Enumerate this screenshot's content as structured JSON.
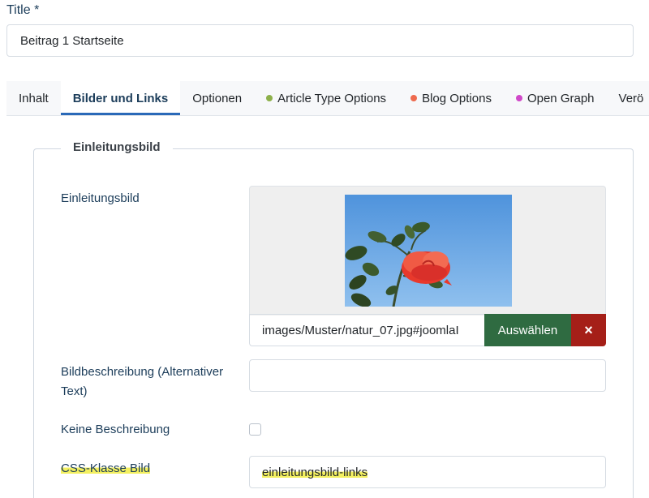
{
  "title_field": {
    "label": "Title *",
    "value": "Beitrag 1 Startseite"
  },
  "tabs": [
    {
      "label": "Inhalt",
      "active": false,
      "dot_color": null
    },
    {
      "label": "Bilder und Links",
      "active": true,
      "dot_color": null
    },
    {
      "label": "Optionen",
      "active": false,
      "dot_color": null
    },
    {
      "label": "Article Type Options",
      "active": false,
      "dot_color": "#8db04a"
    },
    {
      "label": "Blog Options",
      "active": false,
      "dot_color": "#ee6a4e"
    },
    {
      "label": "Open Graph",
      "active": false,
      "dot_color": "#d048c9"
    },
    {
      "label": "Verö",
      "active": false,
      "dot_color": null
    }
  ],
  "intro_image_section": {
    "legend": "Einleitungsbild",
    "image_field": {
      "label": "Einleitungsbild",
      "path_value": "images/Muster/natur_07.jpg#joomlaI",
      "select_label": "Auswählen",
      "clear_label": "×"
    },
    "alt_text_field": {
      "label": "Bildbeschreibung (Alternativer Text)",
      "value": ""
    },
    "no_description_field": {
      "label": "Keine Beschreibung",
      "checked": false
    },
    "css_class_field": {
      "label": "CSS-Klasse Bild",
      "value": "einleitungsbild-links"
    }
  },
  "colors": {
    "accent": "#2a69b8",
    "select_button": "#2f6b41",
    "clear_button": "#a51f18",
    "highlight": "#f3f060"
  }
}
